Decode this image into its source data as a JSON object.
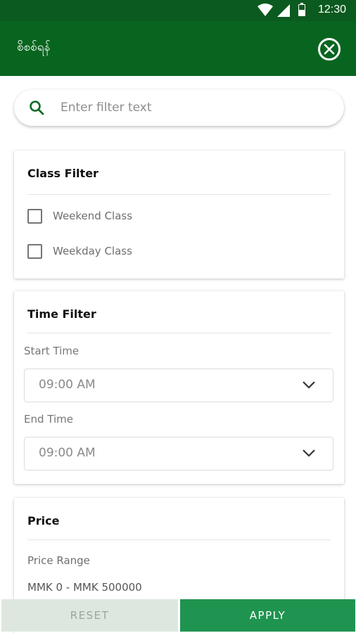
{
  "status_bar": {
    "time": "12:30"
  },
  "app_bar": {
    "title": "စိစစ်ရန်"
  },
  "search": {
    "placeholder": "Enter filter text",
    "value": ""
  },
  "class_filter": {
    "heading": "Class Filter",
    "options": [
      {
        "label": "Weekend Class",
        "checked": false
      },
      {
        "label": "Weekday Class",
        "checked": false
      }
    ]
  },
  "time_filter": {
    "heading": "Time Filter",
    "start_label": "Start Time",
    "start_value": "09:00 AM",
    "end_label": "End Time",
    "end_value": "09:00 AM"
  },
  "price": {
    "heading": "Price",
    "range_label": "Price Range",
    "range_value": "MMK 0 - MMK 500000"
  },
  "actions": {
    "reset": "RESET",
    "apply": "APPLY"
  },
  "colors": {
    "brand": "#08651f",
    "accent": "#1f9450",
    "disabled": "#dde7df"
  }
}
